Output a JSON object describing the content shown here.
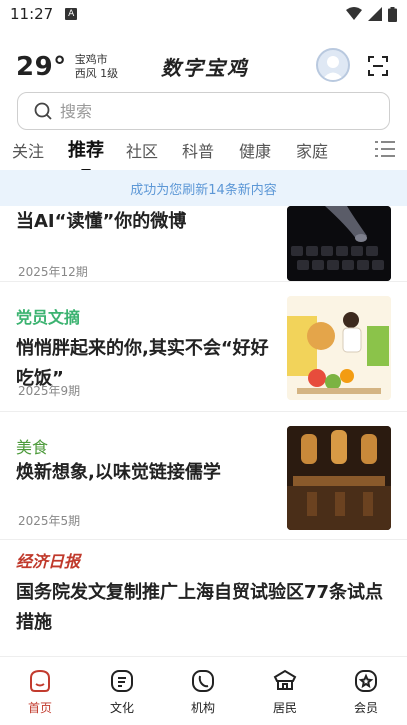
{
  "status_bar": {
    "time": "11:27",
    "sim_label": "A"
  },
  "header": {
    "temperature": "29°",
    "city": "宝鸡市",
    "wind": "西风  1级",
    "brand": "数字宝鸡"
  },
  "search": {
    "placeholder": "搜索"
  },
  "tabs": [
    "关注",
    "推荐",
    "社区",
    "科普",
    "健康",
    "家庭"
  ],
  "active_tab": "推荐",
  "banner": "成功为您刷新14条新内容",
  "feed": [
    {
      "title": "当AI“读懂”你的微博",
      "date": "2025年12期",
      "source": ""
    },
    {
      "source": "党员文摘",
      "source_color": "#3cb371",
      "title": "悄悄胖起来的你,其实不会“好好吃饭”",
      "date": "2025年9期"
    },
    {
      "source": "美食",
      "source_color": "#4c9a3a",
      "title": "焕新想象,以味觉链接儒学",
      "date": "2025年5期"
    },
    {
      "source": "经济日报",
      "source_color": "#c0392b",
      "title": "国务院发文复制推广上海自贸试验区77条试点措施"
    }
  ],
  "nav": [
    {
      "label": "首页",
      "icon": "home-icon",
      "active": true
    },
    {
      "label": "文化",
      "icon": "culture-icon",
      "active": false
    },
    {
      "label": "机构",
      "icon": "phone-icon",
      "active": false
    },
    {
      "label": "居民",
      "icon": "resident-icon",
      "active": false
    },
    {
      "label": "会员",
      "icon": "member-icon",
      "active": false
    }
  ],
  "colors": {
    "accent": "#c23b2e",
    "banner_bg": "#eaf3fc",
    "banner_text": "#5c97d6"
  }
}
